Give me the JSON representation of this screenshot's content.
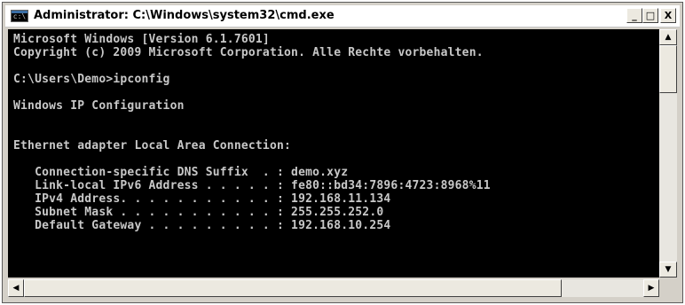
{
  "window": {
    "title": "Administrator: C:\\Windows\\system32\\cmd.exe",
    "icon_label": "c:\\",
    "minimize_glyph": "_",
    "maximize_glyph": "□",
    "close_glyph": "X"
  },
  "console": {
    "lines": [
      "Microsoft Windows [Version 6.1.7601]",
      "Copyright (c) 2009 Microsoft Corporation. Alle Rechte vorbehalten.",
      "",
      "C:\\Users\\Demo>ipconfig",
      "",
      "Windows IP Configuration",
      "",
      "",
      "Ethernet adapter Local Area Connection:",
      "",
      "   Connection-specific DNS Suffix  . : demo.xyz",
      "   Link-local IPv6 Address . . . . . : fe80::bd34:7896:4723:8968%11",
      "   IPv4 Address. . . . . . . . . . . : 192.168.11.134",
      "   Subnet Mask . . . . . . . . . . . : 255.255.252.0",
      "   Default Gateway . . . . . . . . . : 192.168.10.254"
    ],
    "text_color": "#c8c8c8",
    "background_color": "#000000"
  },
  "scrollbars": {
    "up_glyph": "▲",
    "down_glyph": "▼",
    "left_glyph": "◀",
    "right_glyph": "▶"
  }
}
